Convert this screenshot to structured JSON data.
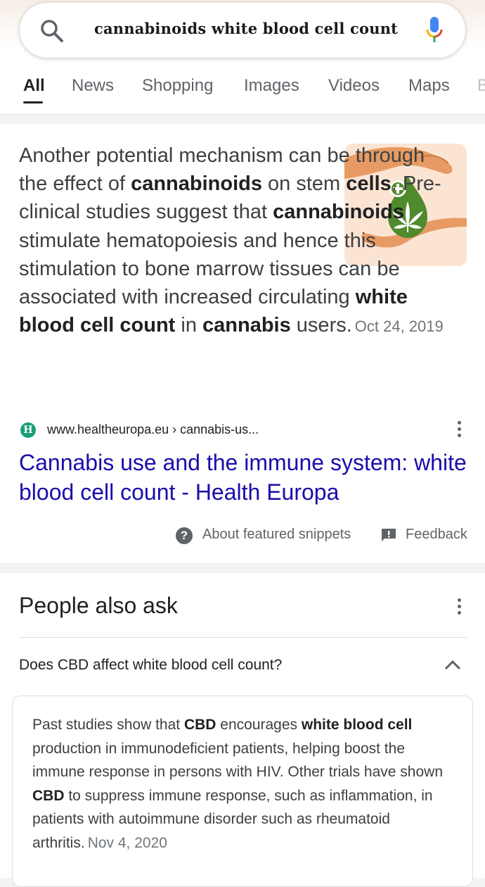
{
  "search": {
    "query": "cannabinoids white blood cell count"
  },
  "tabs": [
    "All",
    "News",
    "Shopping",
    "Images",
    "Videos",
    "Maps",
    "B"
  ],
  "snippet": {
    "parts": [
      {
        "text": "Another potential mechanism can be through the effect of ",
        "bold": false
      },
      {
        "text": "cannabinoids",
        "bold": true
      },
      {
        "text": " on stem ",
        "bold": false
      },
      {
        "text": "cells",
        "bold": true
      },
      {
        "text": ". Pre-clinical studies suggest that ",
        "bold": false
      },
      {
        "text": "cannabinoids",
        "bold": true
      },
      {
        "text": " stimulate hematopoiesis and hence this stimulation to bone marrow tissues can be associated with increased circulating ",
        "bold": false
      },
      {
        "text": "white blood cell count",
        "bold": true
      },
      {
        "text": " in ",
        "bold": false
      },
      {
        "text": "cannabis",
        "bold": true
      },
      {
        "text": " users.",
        "bold": false
      }
    ],
    "date": "Oct 24, 2019",
    "favicon_letter": "H",
    "source_url": "www.healtheuropa.eu › cannabis-us...",
    "title": "Cannabis use and the immune system: white blood cell count - Health Europa",
    "about_label": "About featured snippets",
    "feedback_label": "Feedback"
  },
  "people_also_ask": {
    "title": "People also ask",
    "question": "Does CBD affect white blood cell count?",
    "answer_parts": [
      {
        "text": "Past studies show that ",
        "bold": false
      },
      {
        "text": "CBD",
        "bold": true
      },
      {
        "text": " encourages ",
        "bold": false
      },
      {
        "text": "white blood cell",
        "bold": true
      },
      {
        "text": " production in immunodeficient patients, helping boost the immune response in persons with HIV. Other trials have shown ",
        "bold": false
      },
      {
        "text": "CBD",
        "bold": true
      },
      {
        "text": " to suppress immune response, such as inflammation, in patients with autoimmune disorder such as rheumatoid arthritis.",
        "bold": false
      }
    ],
    "answer_date": "Nov 4, 2020"
  },
  "colors": {
    "link": "#1a0dab",
    "favicon": "#1a9e7a",
    "thumb_bg": "#fbe4d2",
    "hand": "#e79a63",
    "leaf_drop": "#4f8a2c"
  }
}
